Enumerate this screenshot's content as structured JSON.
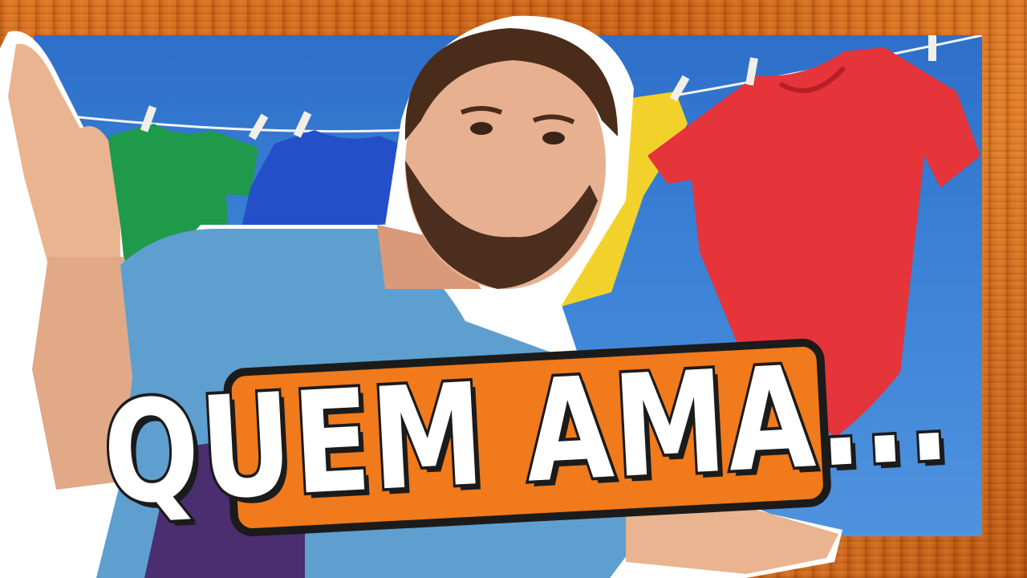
{
  "caption": {
    "text": "QUEM AMA..."
  },
  "colors": {
    "frame_wood": "#d9701f",
    "sky": "#3b82d6",
    "shirt_green": "#1f9a4a",
    "shirt_blue": "#2350c8",
    "shirt_yellow": "#f2d22a",
    "shirt_red": "#e5343a",
    "person_shirt": "#5e9fcf",
    "caption_fill": "#ffffff",
    "caption_outline": "#f07a1c"
  }
}
